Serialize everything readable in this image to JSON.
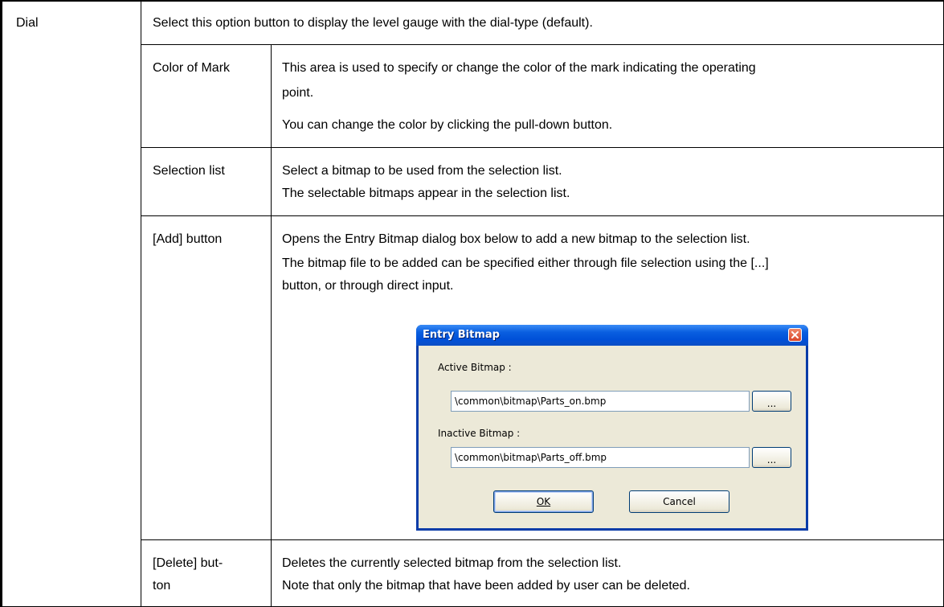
{
  "table": {
    "row_label": "Dial",
    "intro": "Select this option button to display the level gauge with the dial-type (default).",
    "rows": [
      {
        "label_lines": [
          "Color of Mark"
        ],
        "desc_lines": [
          "This area is used to specify or change the color of the mark indicating the operating",
          "point.",
          "You can change the color by clicking the pull-down button."
        ]
      },
      {
        "label_lines": [
          "Selection list"
        ],
        "desc_lines": [
          "Select a bitmap to be used from the selection list.",
          "The selectable bitmaps appear in the selection list."
        ]
      },
      {
        "label_lines": [
          "[Add] button"
        ],
        "desc_lines": [
          "Opens the Entry Bitmap dialog box below to add a new bitmap to the selection list.",
          "The bitmap file to be added can be specified either through file selection using the [...]",
          "button, or through direct input."
        ]
      },
      {
        "label_lines": [
          "[Delete] but-",
          "ton"
        ],
        "desc_lines": [
          "Deletes the currently selected bitmap from the selection list.",
          "Note that only the bitmap that have been added by user can be deleted."
        ]
      }
    ]
  },
  "dialog": {
    "title": "Entry Bitmap",
    "active_label": "Active Bitmap :",
    "active_value": "\\common\\bitmap\\Parts_on.bmp",
    "browse_label": "...",
    "inactive_label": "Inactive Bitmap :",
    "inactive_value": "\\common\\bitmap\\Parts_off.bmp",
    "ok_label": "OK",
    "cancel_label": "Cancel",
    "colors": {
      "title_bar": "#0a5fe0",
      "dialog_face": "#ece9d8",
      "close_button": "#d9462a"
    },
    "icons": [
      "close-icon"
    ]
  }
}
